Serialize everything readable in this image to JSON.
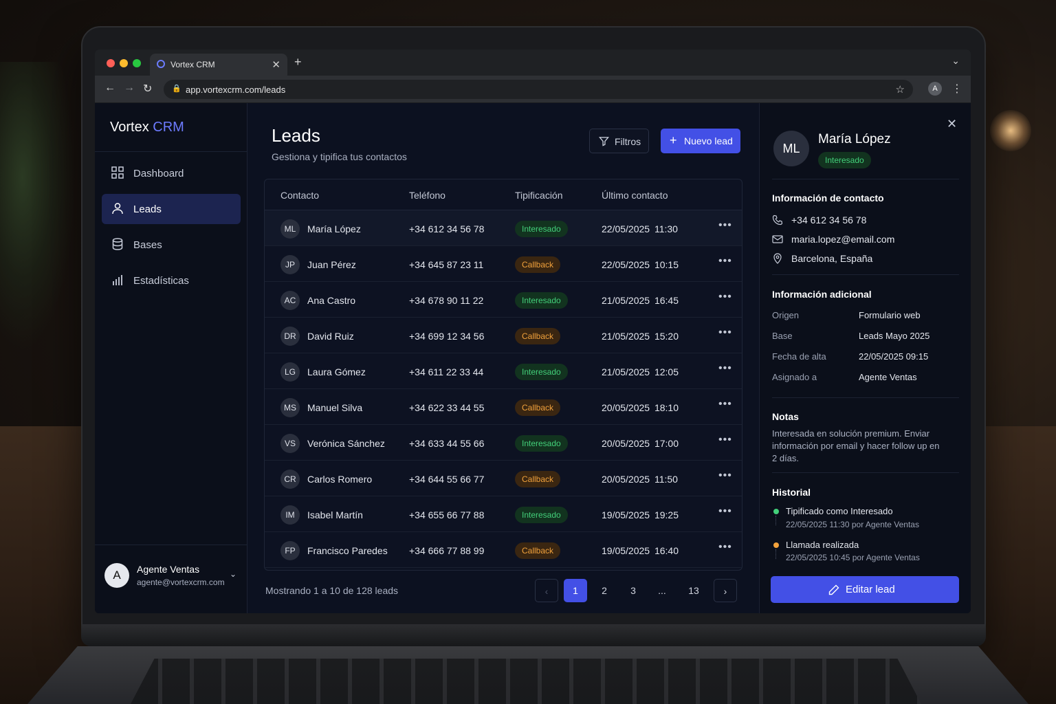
{
  "browser": {
    "tab_title": "Vortex CRM",
    "url": "app.vortexcrm.com/leads",
    "profile_initial": "A"
  },
  "app": {
    "brand_main": "Vortex",
    "brand_accent": "CRM",
    "accent_color": "#4350e6"
  },
  "sidebar": {
    "items": [
      {
        "label": "Dashboard",
        "icon": "grid-icon"
      },
      {
        "label": "Leads",
        "icon": "user-icon",
        "active": true
      },
      {
        "label": "Bases",
        "icon": "database-icon"
      },
      {
        "label": "Estadísticas",
        "icon": "bar-chart-icon"
      }
    ],
    "user": {
      "initial": "A",
      "name": "Agente Ventas",
      "email": "agente@vortexcrm.com"
    }
  },
  "main": {
    "title": "Leads",
    "subtitle": "Gestiona y tipifica tus contactos",
    "filter_label": "Filtros",
    "new_label": "Nuevo lead",
    "columns": [
      "Contacto",
      "Teléfono",
      "Tipificación",
      "Último contacto"
    ],
    "rows": [
      {
        "initials": "ML",
        "name": "María López",
        "phone": "+34 612 34 56 78",
        "status": "Interesado",
        "tone": "green",
        "date": "22/05/2025 11:30"
      },
      {
        "initials": "JP",
        "name": "Juan Pérez",
        "phone": "+34 645 87 23 11",
        "status": "Callback",
        "tone": "orange",
        "date": "22/05/2025 10:15"
      },
      {
        "initials": "AC",
        "name": "Ana Castro",
        "phone": "+34 678 90 11 22",
        "status": "Interesado",
        "tone": "green",
        "date": "21/05/2025 16:45"
      },
      {
        "initials": "DR",
        "name": "David Ruiz",
        "phone": "+34 699 12 34 56",
        "status": "Callback",
        "tone": "orange",
        "date": "21/05/2025 15:20"
      },
      {
        "initials": "LG",
        "name": "Laura Gómez",
        "phone": "+34 611 22 33 44",
        "status": "Interesado",
        "tone": "green",
        "date": "21/05/2025 12:05"
      },
      {
        "initials": "MS",
        "name": "Manuel Silva",
        "phone": "+34 622 33 44 55",
        "status": "Callback",
        "tone": "orange",
        "date": "20/05/2025 18:10"
      },
      {
        "initials": "VS",
        "name": "Verónica Sánchez",
        "phone": "+34 633 44 55 66",
        "status": "Interesado",
        "tone": "green",
        "date": "20/05/2025 17:00"
      },
      {
        "initials": "CR",
        "name": "Carlos Romero",
        "phone": "+34 644 55 66 77",
        "status": "Callback",
        "tone": "orange",
        "date": "20/05/2025 11:50"
      },
      {
        "initials": "IM",
        "name": "Isabel Martín",
        "phone": "+34 655 66 77 88",
        "status": "Interesado",
        "tone": "green",
        "date": "19/05/2025 19:25"
      },
      {
        "initials": "FP",
        "name": "Francisco Paredes",
        "phone": "+34 666 77 88 99",
        "status": "Callback",
        "tone": "orange",
        "date": "19/05/2025 16:40"
      }
    ],
    "showing": "Mostrando 1 a 10 de 128 leads",
    "pagination": {
      "pages": [
        "1",
        "2",
        "3",
        "...",
        "13"
      ],
      "current": "1"
    }
  },
  "panel": {
    "initials": "ML",
    "name": "María López",
    "status": "Interesado",
    "contact_heading": "Información de contacto",
    "phone": "+34 612 34 56 78",
    "email": "maria.lopez@email.com",
    "location": "Barcelona, España",
    "additional_heading": "Información adicional",
    "fields": [
      {
        "key": "Origen",
        "value": "Formulario web"
      },
      {
        "key": "Base",
        "value": "Leads Mayo 2025"
      },
      {
        "key": "Fecha de alta",
        "value": "22/05/2025 09:15"
      },
      {
        "key": "Asignado a",
        "value": "Agente Ventas"
      }
    ],
    "notes_heading": "Notas",
    "notes": "Interesada en solución premium. Enviar información por email y hacer follow up en 2 días.",
    "history_heading": "Historial",
    "history": [
      {
        "title": "Tipificado como Interesado",
        "meta": "22/05/2025 11:30 por Agente Ventas",
        "color": "#43d07a"
      },
      {
        "title": "Llamada realizada",
        "meta": "22/05/2025 10:45 por Agente Ventas",
        "color": "#f2a23c"
      }
    ],
    "edit_label": "Editar lead"
  }
}
